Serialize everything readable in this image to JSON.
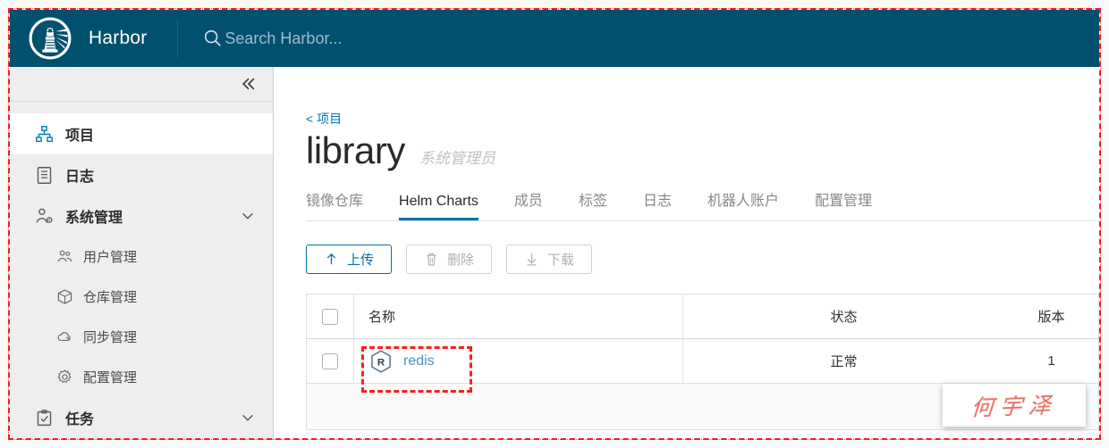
{
  "header": {
    "brand_title": "Harbor",
    "logo_icon": "harbor-lighthouse-logo",
    "search_icon": "search-icon",
    "search_placeholder": "Search Harbor...",
    "search_value": "",
    "background_color": "#00506e"
  },
  "sidebar": {
    "collapse_icon": "double-chevron-left-icon",
    "items": [
      {
        "label": "项目",
        "icon": "sitemap-icon",
        "level": "top",
        "active": true,
        "expandable": false
      },
      {
        "label": "日志",
        "icon": "list-icon",
        "level": "top",
        "active": false,
        "expandable": false
      },
      {
        "label": "系统管理",
        "icon": "user-gear-icon",
        "level": "top",
        "active": false,
        "expandable": true,
        "chevron": "chevron-down-icon"
      },
      {
        "label": "用户管理",
        "icon": "users-icon",
        "level": "sub",
        "active": false,
        "expandable": false
      },
      {
        "label": "仓库管理",
        "icon": "cube-icon",
        "level": "sub",
        "active": false,
        "expandable": false
      },
      {
        "label": "同步管理",
        "icon": "cloud-sync-icon",
        "level": "sub",
        "active": false,
        "expandable": false
      },
      {
        "label": "配置管理",
        "icon": "gear-icon",
        "level": "sub",
        "active": false,
        "expandable": false
      },
      {
        "label": "任务",
        "icon": "clipboard-check-icon",
        "level": "top",
        "active": false,
        "expandable": true,
        "chevron": "chevron-down-icon"
      }
    ]
  },
  "main": {
    "breadcrumb": "< 项目",
    "title": "library",
    "subtitle": "系统管理员",
    "tabs": [
      {
        "label": "镜像仓库",
        "active": false
      },
      {
        "label": "Helm Charts",
        "active": true
      },
      {
        "label": "成员",
        "active": false
      },
      {
        "label": "标签",
        "active": false
      },
      {
        "label": "日志",
        "active": false
      },
      {
        "label": "机器人账户",
        "active": false
      },
      {
        "label": "配置管理",
        "active": false
      }
    ],
    "active_tab_color": "#0072a3",
    "toolbar": {
      "upload_label": "上传",
      "upload_icon": "upload-arrow-icon",
      "upload_enabled": true,
      "delete_label": "删除",
      "delete_icon": "trash-icon",
      "delete_enabled": false,
      "download_label": "下载",
      "download_icon": "download-arrow-icon",
      "download_enabled": false
    },
    "table": {
      "columns": [
        "名称",
        "状态",
        "版本"
      ],
      "select_all_checkbox": false,
      "rows": [
        {
          "checked": false,
          "icon": "helm-chart-hexagon-r-icon",
          "name": "redis",
          "status": "正常",
          "version": "1",
          "highlighted": true
        }
      ]
    }
  },
  "annotations": {
    "screenshot_border_color": "#f41616",
    "highlight_box_color": "#fb1d1d",
    "watermark_text": "何宇泽",
    "watermark_color": "#e8685f"
  }
}
